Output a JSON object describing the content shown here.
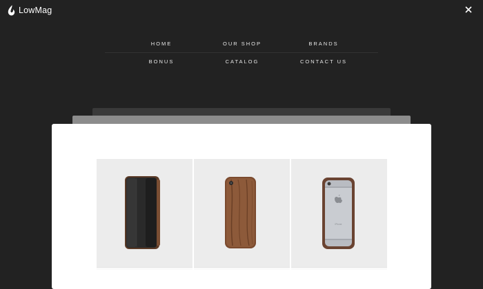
{
  "header": {
    "logo_text": "LowMag",
    "logo_icon": "flame-drop-icon",
    "close_icon": "close-icon"
  },
  "menu": {
    "items": [
      {
        "label": "HOME"
      },
      {
        "label": "OUR SHOP"
      },
      {
        "label": "BRANDS"
      },
      {
        "label": "BONUS"
      },
      {
        "label": "CATALOG"
      },
      {
        "label": "CONTACT US"
      }
    ]
  },
  "products": [
    {
      "image": "black-leather-phone-case"
    },
    {
      "image": "walnut-wood-phone-case"
    },
    {
      "image": "wood-bumper-phone-case"
    }
  ],
  "colors": {
    "background": "#222222",
    "panel": "#ffffff",
    "card": "#ececec",
    "text": "#e6e6e6"
  }
}
